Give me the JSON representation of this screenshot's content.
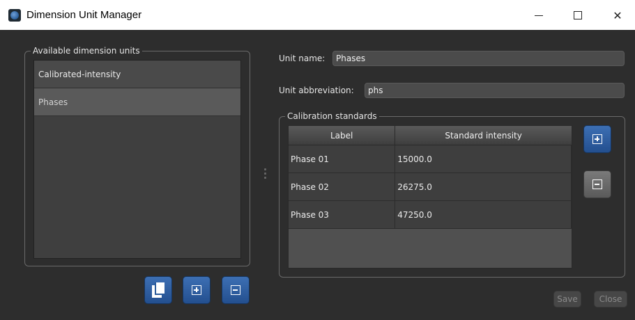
{
  "window": {
    "title": "Dimension Unit Manager",
    "controls": {
      "minimize_icon": "minimize-icon",
      "maximize_icon": "maximize-icon",
      "close_icon": "close-icon"
    }
  },
  "left_panel": {
    "group_title": "Available dimension units",
    "items": [
      {
        "label": "Calibrated-intensity",
        "selected": false
      },
      {
        "label": "Phases",
        "selected": true
      }
    ],
    "buttons": [
      {
        "icon": "copy-icon"
      },
      {
        "icon": "add-icon"
      },
      {
        "icon": "remove-icon"
      }
    ]
  },
  "form": {
    "unit_name_label": "Unit name:",
    "unit_name_value": "Phases",
    "unit_abbreviation_label": "Unit abbreviation:",
    "unit_abbreviation_value": "phs"
  },
  "calibration": {
    "group_title": "Calibration standards",
    "columns": [
      "Label",
      "Standard intensity"
    ],
    "rows": [
      {
        "label": "Phase 01",
        "intensity": "15000.0"
      },
      {
        "label": "Phase 02",
        "intensity": "26275.0"
      },
      {
        "label": "Phase 03",
        "intensity": "47250.0"
      }
    ]
  },
  "footer": {
    "save_label": "Save",
    "close_label": "Close"
  },
  "colors": {
    "background": "#2d2d2d",
    "accent": "#2f5f9e"
  }
}
